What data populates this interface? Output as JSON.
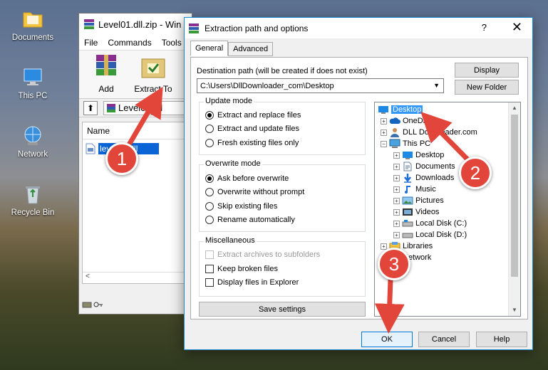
{
  "desktop": {
    "icons": [
      {
        "label": "Documents"
      },
      {
        "label": "This PC"
      },
      {
        "label": "Network"
      },
      {
        "label": "Recycle Bin"
      }
    ]
  },
  "winrar": {
    "title": "Level01.dll.zip - Win",
    "menu": [
      "File",
      "Commands",
      "Tools"
    ],
    "tools": [
      {
        "label": "Add"
      },
      {
        "label": "Extract To"
      }
    ],
    "address": "Level01.dll",
    "column_name": "Name",
    "file": "level01.dll"
  },
  "dialog": {
    "title": "Extraction path and options",
    "help": "?",
    "close": "✕",
    "tabs": [
      {
        "label": "General"
      },
      {
        "label": "Advanced"
      }
    ],
    "destination_label": "Destination path (will be created if does not exist)",
    "destination_value": "C:\\Users\\DllDownloader_com\\Desktop",
    "display_button": "Display",
    "new_folder_button": "New Folder",
    "update_mode": {
      "title": "Update mode",
      "options": [
        "Extract and replace files",
        "Extract and update files",
        "Fresh existing files only"
      ],
      "selected": 0
    },
    "overwrite_mode": {
      "title": "Overwrite mode",
      "options": [
        "Ask before overwrite",
        "Overwrite without prompt",
        "Skip existing files",
        "Rename automatically"
      ],
      "selected": 0
    },
    "misc": {
      "title": "Miscellaneous",
      "options": [
        {
          "label": "Extract archives to subfolders",
          "disabled": true
        },
        {
          "label": "Keep broken files",
          "disabled": false
        },
        {
          "label": "Display files in Explorer",
          "disabled": false
        }
      ]
    },
    "save_settings": "Save settings",
    "tree": [
      {
        "label": "Desktop",
        "icon": "desktop-icon",
        "selected": true
      },
      {
        "label": "OneDrive",
        "icon": "cloud-icon"
      },
      {
        "label": "DLL Downloader.com",
        "icon": "user-icon"
      },
      {
        "label": "This PC",
        "icon": "computer-icon"
      },
      {
        "label": "Desktop",
        "icon": "desktop-icon"
      },
      {
        "label": "Documents",
        "icon": "document-icon"
      },
      {
        "label": "Downloads",
        "icon": "download-icon"
      },
      {
        "label": "Music",
        "icon": "music-icon"
      },
      {
        "label": "Pictures",
        "icon": "picture-icon"
      },
      {
        "label": "Videos",
        "icon": "video-icon"
      },
      {
        "label": "Local Disk (C:)",
        "icon": "disk-icon"
      },
      {
        "label": "Local Disk (D:)",
        "icon": "disk-icon"
      },
      {
        "label": "Libraries",
        "icon": "library-icon"
      },
      {
        "label": "Network",
        "icon": "network-icon"
      }
    ],
    "ok": "OK",
    "cancel": "Cancel",
    "help_button": "Help"
  },
  "callouts": [
    "1",
    "2",
    "3"
  ],
  "colors": {
    "callout": "#e2453a",
    "selection": "#3399ff",
    "accent": "#0078d7"
  }
}
